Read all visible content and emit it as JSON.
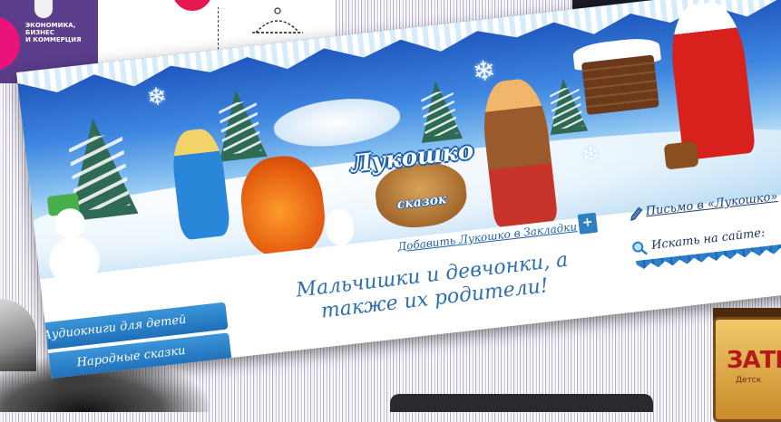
{
  "promo": {
    "text_line1": "ЭКОНОМИКА, БИЗНЕС",
    "text_line2": "И КОММЕРЦИЯ"
  },
  "site": {
    "logo_title": "Лукошко",
    "logo_subtitle": "сказок",
    "bookmark_link": "Добавить Лукошко в Закладки",
    "bookmark_plus": "+",
    "letter_link": "Письмо в «Лукошко»",
    "search_label": "Искать на сайте:",
    "tagline_line1": "Мальчишки и девчонки, а",
    "tagline_line2": "также их родители!",
    "nav": [
      {
        "label": "Аудиокниги для детей"
      },
      {
        "label": "Народные сказки"
      }
    ]
  },
  "sign": {
    "title": "ЗАТЕ",
    "subtitle": "Детск"
  },
  "colors": {
    "nav_blue": "#2c7fcc",
    "link_blue": "#1c5fa8",
    "tagline_blue": "#2e6fae"
  }
}
